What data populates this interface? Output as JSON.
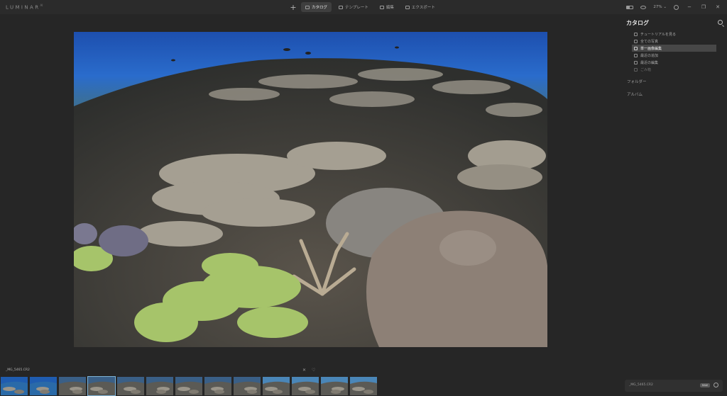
{
  "app": {
    "logo": "LUMINAR",
    "logo_sup": "AI"
  },
  "nav": {
    "add_label": "+",
    "tabs": [
      {
        "label": "カタログ",
        "icon": "catalog-icon",
        "active": true
      },
      {
        "label": "テンプレート",
        "icon": "templates-icon",
        "active": false
      },
      {
        "label": "編集",
        "icon": "edit-icon",
        "active": false
      },
      {
        "label": "エクスポート",
        "icon": "export-icon",
        "active": false
      }
    ]
  },
  "toolbar": {
    "zoom": "27%",
    "zoom_caret": "⌄"
  },
  "window": {
    "minimize": "−",
    "restore": "❐",
    "close": "✕"
  },
  "panel": {
    "title": "カタログ",
    "items": [
      {
        "label": "チュートリアルを見る",
        "icon": "tutorial-icon"
      },
      {
        "label": "全ての写真",
        "icon": "photos-icon"
      },
      {
        "label": "単一画像編集",
        "icon": "single-image-icon",
        "selected": true
      },
      {
        "label": "最近の追加",
        "icon": "recent-add-icon"
      },
      {
        "label": "最近の編集",
        "icon": "recent-edit-icon"
      },
      {
        "label": "ごみ箱",
        "icon": "trash-icon",
        "dim": true
      }
    ],
    "folders_label": "フォルダー",
    "albums_label": "アルバム"
  },
  "filename": {
    "name": "_MG_5465.CR2",
    "badge": "RAW"
  },
  "filmstrip": {
    "current_name": "_MG_5465.CR2",
    "close_label": "✕",
    "heart_label": "♡",
    "thumb_count": 13,
    "selected_index": 3
  },
  "colors": {
    "water_top": "#1a4fa8",
    "water_bottom": "#2c6fcf",
    "coral_green": "#a6c46a",
    "coral_plate": "#9a9384",
    "selection_border": "#7fb4d8"
  }
}
